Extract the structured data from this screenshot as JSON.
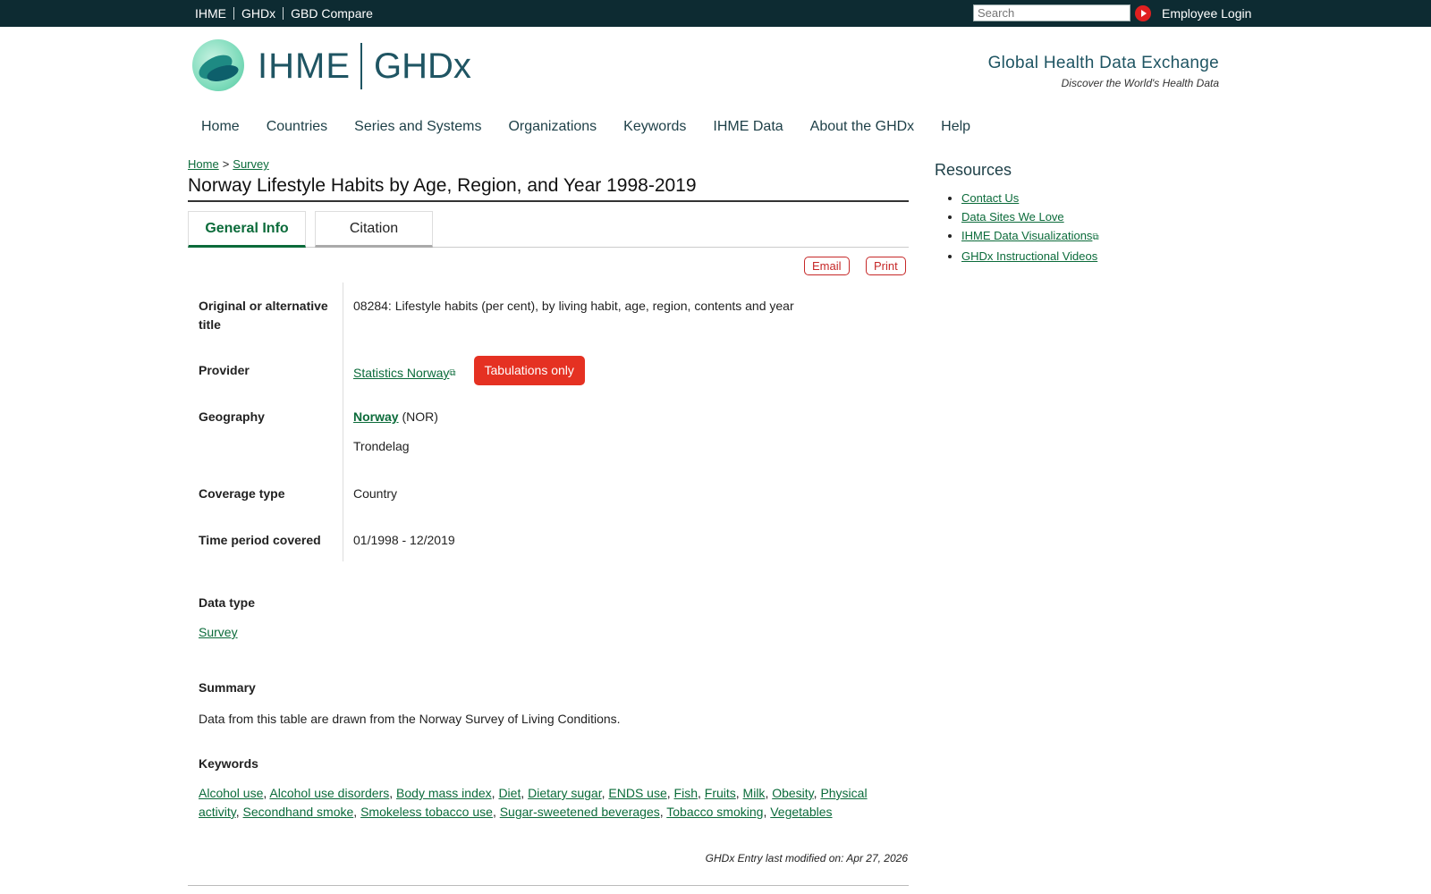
{
  "topbar": {
    "links": [
      "IHME",
      "GHDx",
      "GBD Compare"
    ],
    "search_placeholder": "Search",
    "login_label": "Employee Login"
  },
  "brand": {
    "ihme": "IHME",
    "ghdx": "GHDx",
    "tagline_title": "Global Health Data Exchange",
    "tagline_sub": "Discover the World's Health Data"
  },
  "nav": [
    "Home",
    "Countries",
    "Series and Systems",
    "Organizations",
    "Keywords",
    "IHME Data",
    "About the GHDx",
    "Help"
  ],
  "breadcrumb": {
    "home": "Home",
    "sep": ">",
    "current": "Survey"
  },
  "page_title": "Norway Lifestyle Habits by Age, Region, and Year 1998-2019",
  "tabs": {
    "active": "General Info",
    "inactive": "Citation"
  },
  "actions": {
    "email": "Email",
    "print": "Print"
  },
  "meta": {
    "original_title_label": "Original or alternative title",
    "original_title_value": "08284: Lifestyle habits (per cent), by living habit, age, region, contents and year",
    "provider_label": "Provider",
    "provider_value": "Statistics Norway",
    "provider_badge": "Tabulations only",
    "geography_label": "Geography",
    "geography_country": "Norway",
    "geography_code": "(NOR)",
    "geography_region": "Trondelag",
    "coverage_label": "Coverage type",
    "coverage_value": "Country",
    "period_label": "Time period covered",
    "period_value": "01/1998 - 12/2019"
  },
  "data_type": {
    "label": "Data type",
    "value": "Survey"
  },
  "summary": {
    "label": "Summary",
    "value": "Data from this table are drawn from the Norway Survey of Living Conditions."
  },
  "keywords": {
    "label": "Keywords",
    "items": [
      "Alcohol use",
      "Alcohol use disorders",
      "Body mass index",
      "Diet",
      "Dietary sugar",
      "ENDS use",
      "Fish",
      "Fruits",
      "Milk",
      "Obesity",
      "Physical activity",
      "Secondhand smoke",
      "Smokeless tobacco use",
      "Sugar-sweetened beverages",
      "Tobacco smoking",
      "Vegetables"
    ]
  },
  "modified": "GHDx Entry last modified on: Apr 27, 2026",
  "resources": {
    "title": "Resources",
    "items": [
      "Contact Us",
      "Data Sites We Love",
      "IHME Data Visualizations",
      "GHDx Instructional Videos"
    ]
  },
  "icons": {
    "external": "external-link-icon",
    "search_go": "play-arrow-icon",
    "logo": "ihme-leaf-logo"
  },
  "colors": {
    "topbar": "#0d2b32",
    "link": "#0b6b3a",
    "accent_red": "#e53122",
    "brand_teal": "#1f5563"
  }
}
